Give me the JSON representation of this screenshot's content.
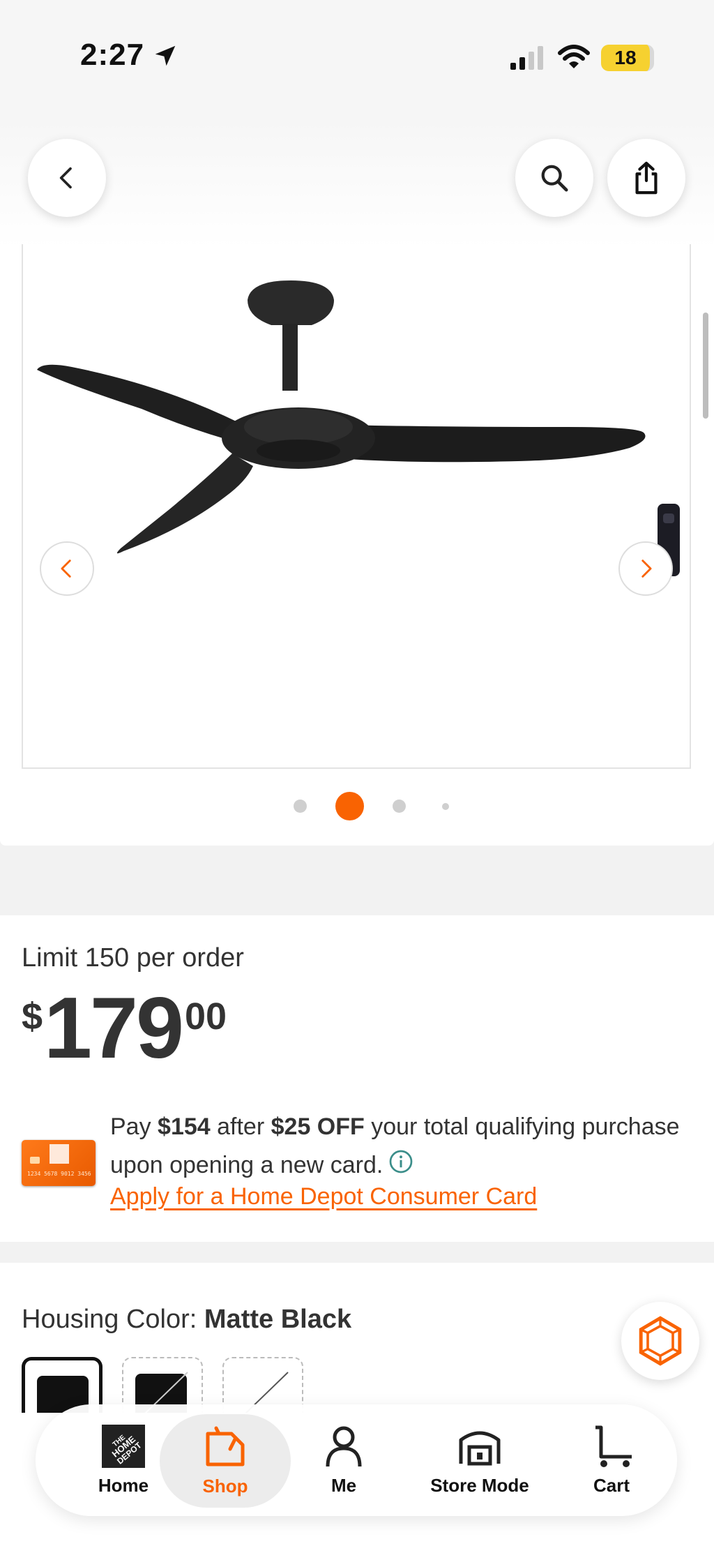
{
  "status_bar": {
    "time": "2:27",
    "battery": "18",
    "icons": [
      "location-arrow-icon",
      "cellular-signal-icon",
      "wifi-icon",
      "battery-icon"
    ]
  },
  "header": {
    "icons": [
      "back-chevron-icon",
      "search-icon",
      "share-icon"
    ]
  },
  "gallery": {
    "product_image": "ceiling-fan-matte-black-with-remote",
    "prev_icon": "chevron-left-icon",
    "next_icon": "chevron-right-icon",
    "dots_count": 4,
    "active_dot": 2
  },
  "pricing": {
    "limit": "Limit 150 per order",
    "currency": "$",
    "price_whole": "179",
    "price_cents": "00"
  },
  "promo": {
    "pay_prefix": "Pay ",
    "pay_amount": "$154",
    "after_text": " after ",
    "discount": "$25 OFF",
    "rest_line": " your total qualifying purchase upon opening a new card.",
    "apply_link": "Apply for a Home Depot Consumer Card",
    "card_number": "1234 5678 9012 3456"
  },
  "color": {
    "label": "Housing Color: ",
    "value": "Matte Black",
    "swatches": [
      {
        "color": "#111111",
        "selected": true
      },
      {
        "color": "#111111",
        "selected": false
      },
      {
        "color": "#ffffff",
        "selected": false
      }
    ]
  },
  "tabs": [
    {
      "label": "Home",
      "icon": "home-depot-logo-icon"
    },
    {
      "label": "Shop",
      "icon": "shop-tag-icon",
      "active": true
    },
    {
      "label": "Me",
      "icon": "person-icon"
    },
    {
      "label": "Store Mode",
      "icon": "store-icon"
    },
    {
      "label": "Cart",
      "icon": "cart-icon"
    }
  ],
  "colors": {
    "accent": "#f96302",
    "text": "#333333",
    "background": "#f2f2f2"
  }
}
